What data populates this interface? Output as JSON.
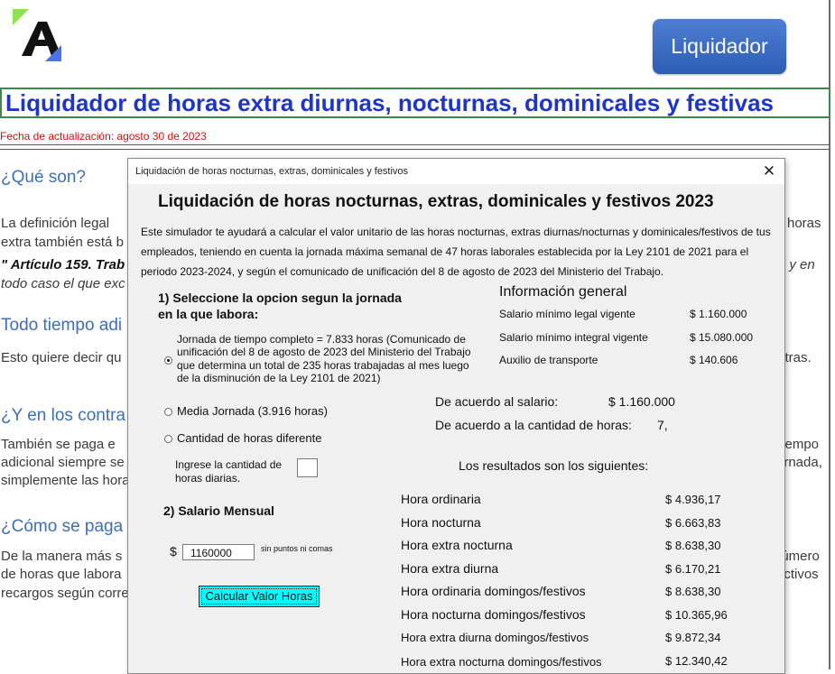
{
  "page": {
    "liquidador_button": "Liquidador",
    "title": "Liquidador de horas extra diurnas, nocturnas, dominicales y festivas",
    "update_date": "Fecha de actualización: agosto 30 de 2023",
    "section1_heading": "¿Qué son?",
    "para1_line1_left": "La definición legal",
    "para1_line1_right": "horas",
    "para1_line2_left": "extra también está b",
    "para1_line3_left": "\" Artículo 159. Trab",
    "para1_line3_right": ", y en",
    "para1_line4_left": "todo caso el que exc",
    "section2_heading": "Todo tiempo adi",
    "para2_left": "Esto quiere decir qu",
    "para2_right": "xtras.",
    "section3_heading": "¿Y en los contra",
    "para3_line1_left": "También se paga e",
    "para3_line1_right": "tiempo",
    "para3_line2_left": "adicional siempre se",
    "para3_line2_right": "ornada,",
    "para3_line3_left": "simplemente las hora",
    "section4_heading": "¿Cómo se paga",
    "para4_line1_left": "De la manera más s",
    "para4_line1_right": "número",
    "para4_line2_left": "de horas que labora",
    "para4_line2_right": "ectivos",
    "para4_line3_left": "recargos según corre"
  },
  "dialog": {
    "caption": "Liquidación de horas nocturnas, extras, dominicales y festivos",
    "close_glyph": "✕",
    "title": "Liquidación de horas nocturnas, extras, dominicales y festivos 2023",
    "description": "Este simulador te ayudará a calcular el valor unitario de las horas nocturnas, extras diurnas/nocturnas y dominicales/festivos de tus empleados, teniendo en cuenta la jornada máxima semanal de 47 horas laborales establecida por la Ley 2101 de 2021 para el periodo 2023-2024, y según el comunicado de unificación del 8 de agosto de 2023 del Ministerio del Trabajo.",
    "section1_line1": "1) Seleccione la opcion segun la jornada",
    "section1_line2": "en la que labora:",
    "option_full_l1": "Jornada de tiempo completo = 7.833 horas (Comunicado de",
    "option_full_l2": "unificación del 8 de agosto de 2023 del Ministerio del Trabajo",
    "option_full_l3": "que determina un total de 235 horas trabajadas al mes luego",
    "option_full_l4": "de la disminución de la Ley 2101 de 2021)",
    "option_half": "Media Jornada (3.916 horas)",
    "option_custom": "Cantidad de horas diferente",
    "custom_label_l1": "Ingrese la cantidad de",
    "custom_label_l2": "horas diarias.",
    "selected_option": "full",
    "section2": "2) Salario Mensual",
    "currency_symbol": "$",
    "salary_value": "1160000",
    "salary_hint": "sin puntos ni comas",
    "calc_button": "Calcular Valor Horas",
    "info_title": "Información general",
    "info": [
      {
        "label": "Salario mínimo legal vigente",
        "value": "$ 1.160.000"
      },
      {
        "label": "Salario mínimo integral vigente",
        "value": "$ 15.080.000"
      },
      {
        "label": "Auxilio de transporte",
        "value": "$ 140.606"
      }
    ],
    "by_salary_label": "De acuerdo al salario:",
    "by_salary_value": "$ 1.160.000",
    "by_hours_label": "De acuerdo a la cantidad de horas:",
    "by_hours_value": "7,",
    "results_title": "Los resultados son los siguientes:",
    "results": [
      {
        "label": "Hora ordinaria",
        "value": "$ 4.936,17"
      },
      {
        "label": "Hora nocturna",
        "value": "$ 6.663,83"
      },
      {
        "label": "Hora extra nocturna",
        "value": "$ 8.638,30"
      },
      {
        "label": "Hora extra diurna",
        "value": "$ 6.170,21"
      },
      {
        "label": "Hora ordinaria domingos/festivos",
        "value": "$ 8.638,30"
      },
      {
        "label": "Hora nocturna domingos/festivos",
        "value": "$ 10.365,96"
      },
      {
        "label": "Hora extra diurna domingos/festivos",
        "value": "$ 9.872,34"
      },
      {
        "label": "Hora extra nocturna domingos/festivos",
        "value": "$ 12.340,42"
      }
    ]
  }
}
